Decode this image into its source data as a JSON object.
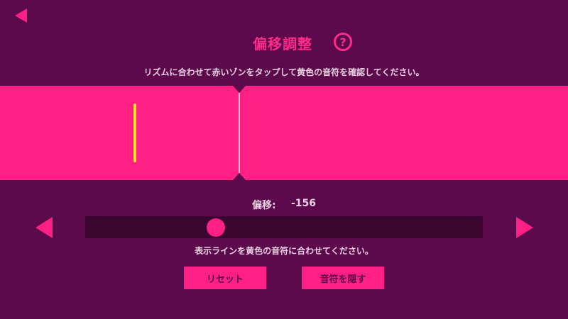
{
  "header": {
    "title": "偏移調整",
    "help_icon": "?"
  },
  "instruction": "リズムに合わせて赤いゾンをタップして黄色の音符を確認してください。",
  "offset": {
    "label": "偏移:",
    "value": "-156",
    "slider_fraction": 0.32
  },
  "hint": "表示ラインを黄色の音符に合わせてください。",
  "buttons": {
    "reset": "リセット",
    "hide_notes": "音符を隠す"
  },
  "icons": {
    "back": "back-arrow-icon",
    "decrease": "left-arrow-icon",
    "increase": "right-arrow-icon",
    "help": "help-icon"
  },
  "colors": {
    "background": "#5c0a4b",
    "accent": "#ff1f85",
    "note": "#ffe31a",
    "slider_track": "#3a0630"
  }
}
